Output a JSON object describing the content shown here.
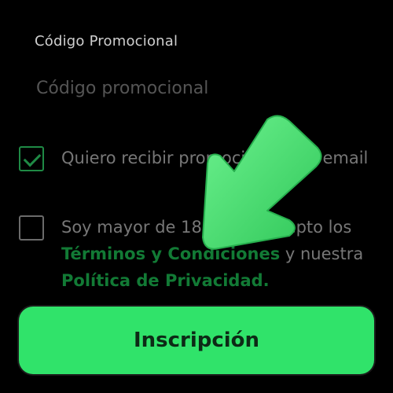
{
  "promo": {
    "label": "Código Promocional",
    "placeholder": "Código promocional"
  },
  "optin": {
    "checked": true,
    "text": "Quiero recibir promociones por email"
  },
  "terms": {
    "checked": false,
    "prefix": "Soy mayor de 18 años y acepto los ",
    "terms_link": "Términos y Condiciones",
    "middle": " y nuestra ",
    "privacy_link": "Política de Privacidad."
  },
  "signup_button": {
    "label": "Inscripción"
  },
  "overlay": {
    "icon": "arrow-down-left-icon",
    "color": "#3ddc6a"
  },
  "colors": {
    "background": "#000000",
    "accent": "#30e36a",
    "link": "#127a35"
  }
}
